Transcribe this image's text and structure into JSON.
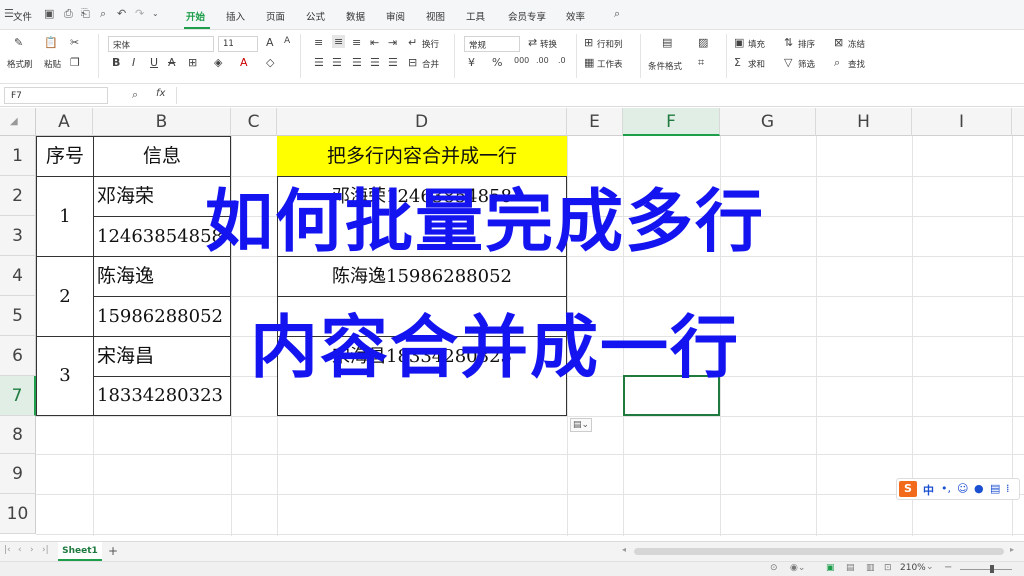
{
  "menu": {
    "file": "文件",
    "tabs": [
      "开始",
      "插入",
      "页面",
      "公式",
      "数据",
      "审阅",
      "视图",
      "工具",
      "会员专享",
      "效率"
    ]
  },
  "ribbon": {
    "format_painter": "格式刷",
    "paste": "粘贴",
    "font_name": "宋体",
    "font_size": "11",
    "wrap": "换行",
    "merge": "合并",
    "number_format": "常规",
    "convert": "转换",
    "rows_cols": "行和列",
    "worksheet": "工作表",
    "cond_format": "条件格式",
    "fill": "填充",
    "sort": "排序",
    "freeze": "冻结",
    "sum": "求和",
    "filter": "筛选",
    "find": "查找"
  },
  "formula_bar": {
    "cell_ref": "F7",
    "fx": "fx"
  },
  "columns": [
    "A",
    "B",
    "C",
    "D",
    "E",
    "F",
    "G",
    "H",
    "I"
  ],
  "rows": [
    "1",
    "2",
    "3",
    "4",
    "5",
    "6",
    "7",
    "8",
    "9",
    "10"
  ],
  "cells": {
    "A1": "序号",
    "B1": "信息",
    "A_group1": "1",
    "A_group2": "2",
    "A_group3": "3",
    "B2": "邓海荣",
    "B3": "12463854858",
    "B4": "陈海逸",
    "B5": "15986288052",
    "B6": "宋海昌",
    "B7": "18334280323",
    "D1": "把多行内容合并成一行",
    "D_group1": "邓海荣12463854858",
    "D_group2": "陈海逸15986288052",
    "D_group3": "宋海昌18334280323"
  },
  "overlay": {
    "line1": "如何批量完成多行",
    "line2": "内容合并成一行"
  },
  "sheet_tab": "Sheet1",
  "ime": {
    "label": "中"
  },
  "status": {
    "zoom": "210%"
  },
  "colors": {
    "accent": "#1e9e4a",
    "header_fill": "#ffff00",
    "overlay": "#1414f0",
    "ime": "#f26b1d"
  }
}
